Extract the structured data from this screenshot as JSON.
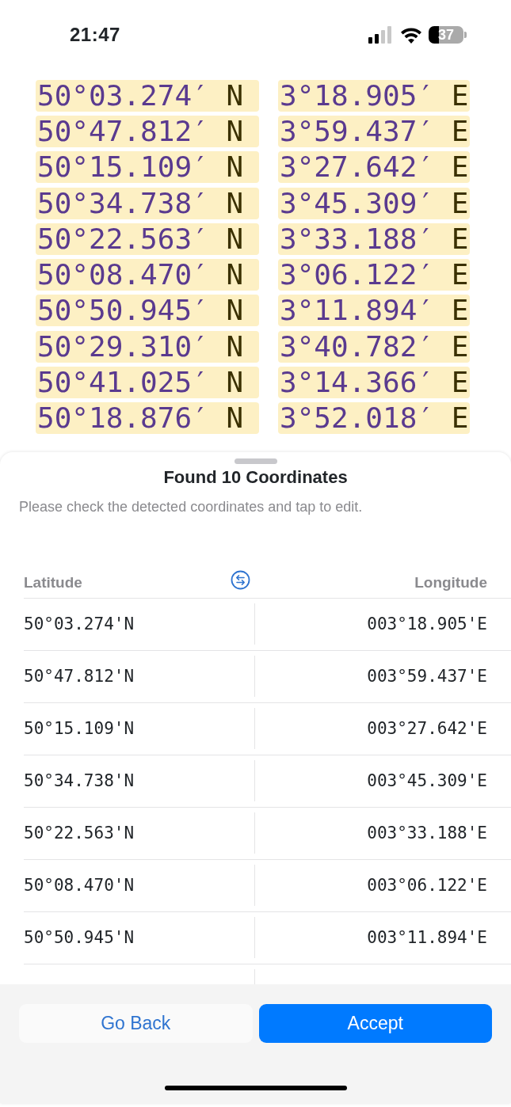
{
  "status_bar": {
    "time": "21:47",
    "battery": "37"
  },
  "scanned_text": [
    {
      "lat_value": "50°03.274′",
      "lat_hemisphere": "N",
      "lon_value": "3°18.905′",
      "lon_hemisphere": "E"
    },
    {
      "lat_value": "50°47.812′",
      "lat_hemisphere": "N",
      "lon_value": "3°59.437′",
      "lon_hemisphere": "E"
    },
    {
      "lat_value": "50°15.109′",
      "lat_hemisphere": "N",
      "lon_value": "3°27.642′",
      "lon_hemisphere": "E"
    },
    {
      "lat_value": "50°34.738′",
      "lat_hemisphere": "N",
      "lon_value": "3°45.309′",
      "lon_hemisphere": "E"
    },
    {
      "lat_value": "50°22.563′",
      "lat_hemisphere": "N",
      "lon_value": "3°33.188′",
      "lon_hemisphere": "E"
    },
    {
      "lat_value": "50°08.470′",
      "lat_hemisphere": "N",
      "lon_value": "3°06.122′",
      "lon_hemisphere": "E"
    },
    {
      "lat_value": "50°50.945′",
      "lat_hemisphere": "N",
      "lon_value": "3°11.894′",
      "lon_hemisphere": "E"
    },
    {
      "lat_value": "50°29.310′",
      "lat_hemisphere": "N",
      "lon_value": "3°40.782′",
      "lon_hemisphere": "E"
    },
    {
      "lat_value": "50°41.025′",
      "lat_hemisphere": "N",
      "lon_value": "3°14.366′",
      "lon_hemisphere": "E"
    },
    {
      "lat_value": "50°18.876′",
      "lat_hemisphere": "N",
      "lon_value": "3°52.018′",
      "lon_hemisphere": "E"
    }
  ],
  "sheet": {
    "title": "Found 10 Coordinates",
    "subtitle": "Please check the detected coordinates and tap to edit.",
    "table": {
      "columns": [
        "Latitude",
        "Longitude"
      ],
      "rows": [
        {
          "latitude": "50°03.274'N",
          "longitude": "003°18.905'E"
        },
        {
          "latitude": "50°47.812'N",
          "longitude": "003°59.437'E"
        },
        {
          "latitude": "50°15.109'N",
          "longitude": "003°27.642'E"
        },
        {
          "latitude": "50°34.738'N",
          "longitude": "003°45.309'E"
        },
        {
          "latitude": "50°22.563'N",
          "longitude": "003°33.188'E"
        },
        {
          "latitude": "50°08.470'N",
          "longitude": "003°06.122'E"
        },
        {
          "latitude": "50°50.945'N",
          "longitude": "003°11.894'E"
        }
      ]
    },
    "buttons": [
      {
        "label": "Go Back",
        "kind": "secondary"
      },
      {
        "label": "Accept",
        "kind": "primary"
      }
    ]
  }
}
